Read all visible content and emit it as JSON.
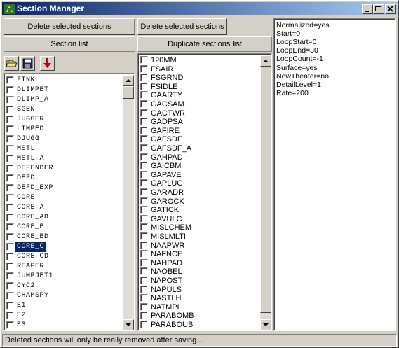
{
  "window": {
    "title": "Section Manager",
    "status_text": "Deleted sections will only be really removed after saving..."
  },
  "left_panel": {
    "delete_button_label": "Delete selected sections",
    "header": "Section list",
    "toolbar": [
      "open-folder-icon",
      "save-disk-icon",
      "delete-down-arrow-icon"
    ],
    "items": [
      "FTNK",
      "DLIMPET",
      "DLIMP_A",
      "SGEN",
      "JUGGER",
      "LIMPED",
      "DJUGG",
      "MSTL",
      "MSTL_A",
      "DEFENDER",
      "DEFD",
      "DEFD_EXP",
      "CORE",
      "CORE_A",
      "CORE_AD",
      "CORE_B",
      "CORE_BD",
      "CORE_C",
      "CORE_CD",
      "REAPER",
      "JUMPJET1",
      "CYC2",
      "CHAMSPY",
      "E1",
      "E2",
      "E3"
    ],
    "selected_index": 17
  },
  "middle_panel": {
    "delete_button_label": "Delete selected sections",
    "header": "Duplicate sections list",
    "items": [
      "120MM",
      "FSAIR",
      "FSGRND",
      "FSIDLE",
      "GAARTY",
      "GACSAM",
      "GACTWR",
      "GADPSA",
      "GAFIRE",
      "GAFSDF",
      "GAFSDF_A",
      "GAHPAD",
      "GAICBM",
      "GAPAVE",
      "GAPLUG",
      "GARADR",
      "GAROCK",
      "GATICK",
      "GAVULC",
      "MISLCHEM",
      "MISLMLTI",
      "NAAPWR",
      "NAFNCE",
      "NAHPAD",
      "NAOBEL",
      "NAPOST",
      "NAPULS",
      "NASTLH",
      "NATMPL",
      "PARABOMB",
      "PARABOUB"
    ]
  },
  "properties": {
    "lines": [
      "Normalized=yes",
      "Start=0",
      "LoopStart=0",
      "LoopEnd=30",
      "LoopCount=-1",
      "Surface=yes",
      "NewTheater=no",
      "DetailLevel=1",
      "Rate=200"
    ]
  },
  "colors": {
    "titlebar_start": "#0a246a",
    "titlebar_end": "#a6caf0",
    "selection": "#0a246a",
    "face": "#d4d0c8"
  }
}
